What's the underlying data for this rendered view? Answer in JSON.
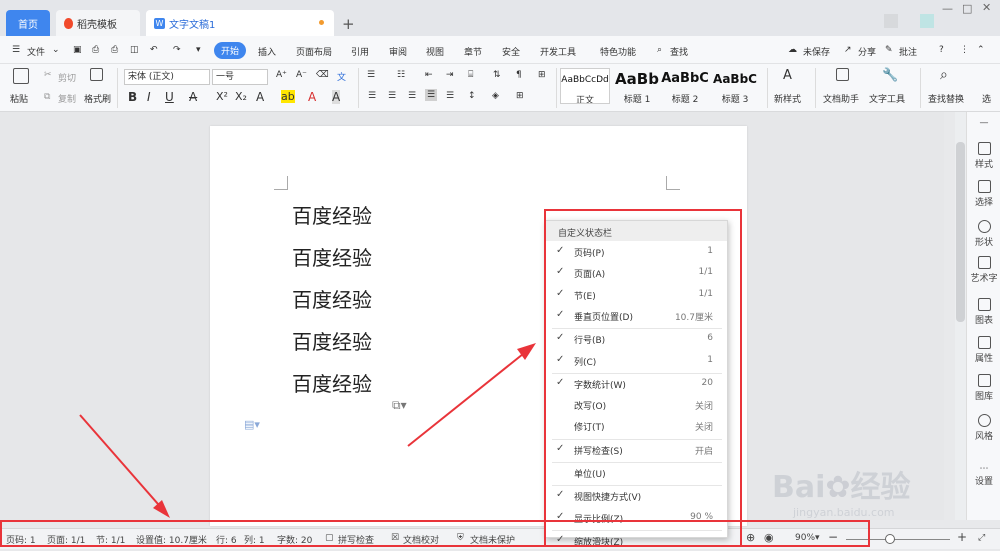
{
  "tabs": {
    "home": "首页",
    "templates": "稻壳模板",
    "document": "文字文稿1",
    "add": "+"
  },
  "menubar": {
    "file": "文件",
    "start": "开始",
    "insert": "插入",
    "layout": "页面布局",
    "references": "引用",
    "review": "审阅",
    "view": "视图",
    "chapter": "章节",
    "security": "安全",
    "dev_tools": "开发工具",
    "features": "特色功能",
    "search": "查找",
    "unsaved": "未保存",
    "share": "分享",
    "comment": "批注",
    "help": "?"
  },
  "ribbon": {
    "paste": "粘贴",
    "cut": "剪切",
    "copy": "复制",
    "format_painter": "格式刷",
    "font_name": "宋体 (正文)",
    "font_size": "一号",
    "styles": [
      {
        "preview": "AaBbCcDd",
        "label": "正文"
      },
      {
        "preview": "AaBb",
        "label": "标题 1"
      },
      {
        "preview": "AaBbC",
        "label": "标题 2"
      },
      {
        "preview": "AaBbC",
        "label": "标题 3"
      }
    ],
    "new_style": "新样式",
    "doc_assistant": "文档助手",
    "text_tools": "文字工具",
    "find_replace": "查找替换",
    "select": "选"
  },
  "document": {
    "lines": [
      "百度经验",
      "百度经验",
      "百度经验",
      "百度经验",
      "百度经验"
    ]
  },
  "sidebar": {
    "items": [
      "样式",
      "选择",
      "形状",
      "艺术字",
      "图表",
      "属性",
      "图库",
      "风格",
      "设置"
    ]
  },
  "context_menu": {
    "title": "自定义状态栏",
    "items": [
      {
        "label": "页码(P)",
        "value": "1",
        "checked": true
      },
      {
        "label": "页面(A)",
        "value": "1/1",
        "checked": true
      },
      {
        "label": "节(E)",
        "value": "1/1",
        "checked": true
      },
      {
        "label": "垂直页位置(D)",
        "value": "10.7厘米",
        "checked": true
      },
      {
        "label": "行号(B)",
        "value": "6",
        "checked": true
      },
      {
        "label": "列(C)",
        "value": "1",
        "checked": true
      },
      {
        "label": "字数统计(W)",
        "value": "20",
        "checked": true
      },
      {
        "label": "改写(O)",
        "value": "关闭",
        "checked": false
      },
      {
        "label": "修订(T)",
        "value": "关闭",
        "checked": false
      },
      {
        "label": "拼写检查(S)",
        "value": "开启",
        "checked": true
      },
      {
        "label": "单位(U)",
        "value": "",
        "checked": false
      },
      {
        "label": "视图快捷方式(V)",
        "value": "",
        "checked": true
      },
      {
        "label": "显示比例(Z)",
        "value": "90 %",
        "checked": true
      },
      {
        "label": "缩放滑块(Z)",
        "value": "",
        "checked": true
      }
    ]
  },
  "statusbar": {
    "page": "页码: 1",
    "pages": "页面: 1/1",
    "section": "节: 1/1",
    "position": "设置值: 10.7厘米",
    "row": "行: 6",
    "col": "列: 1",
    "wordcount": "字数: 20",
    "spellcheck": "拼写检查",
    "proofread": "文档校对",
    "unprotected": "文档未保护",
    "zoom": "90%",
    "zoom_minus": "−",
    "zoom_plus": "+"
  },
  "watermark": {
    "brand": "Bai",
    "brand_cn": "经验",
    "url": "jingyan.baidu.com"
  },
  "colors": {
    "accent": "#3f86ee",
    "annotation_red": "#e9343a"
  }
}
